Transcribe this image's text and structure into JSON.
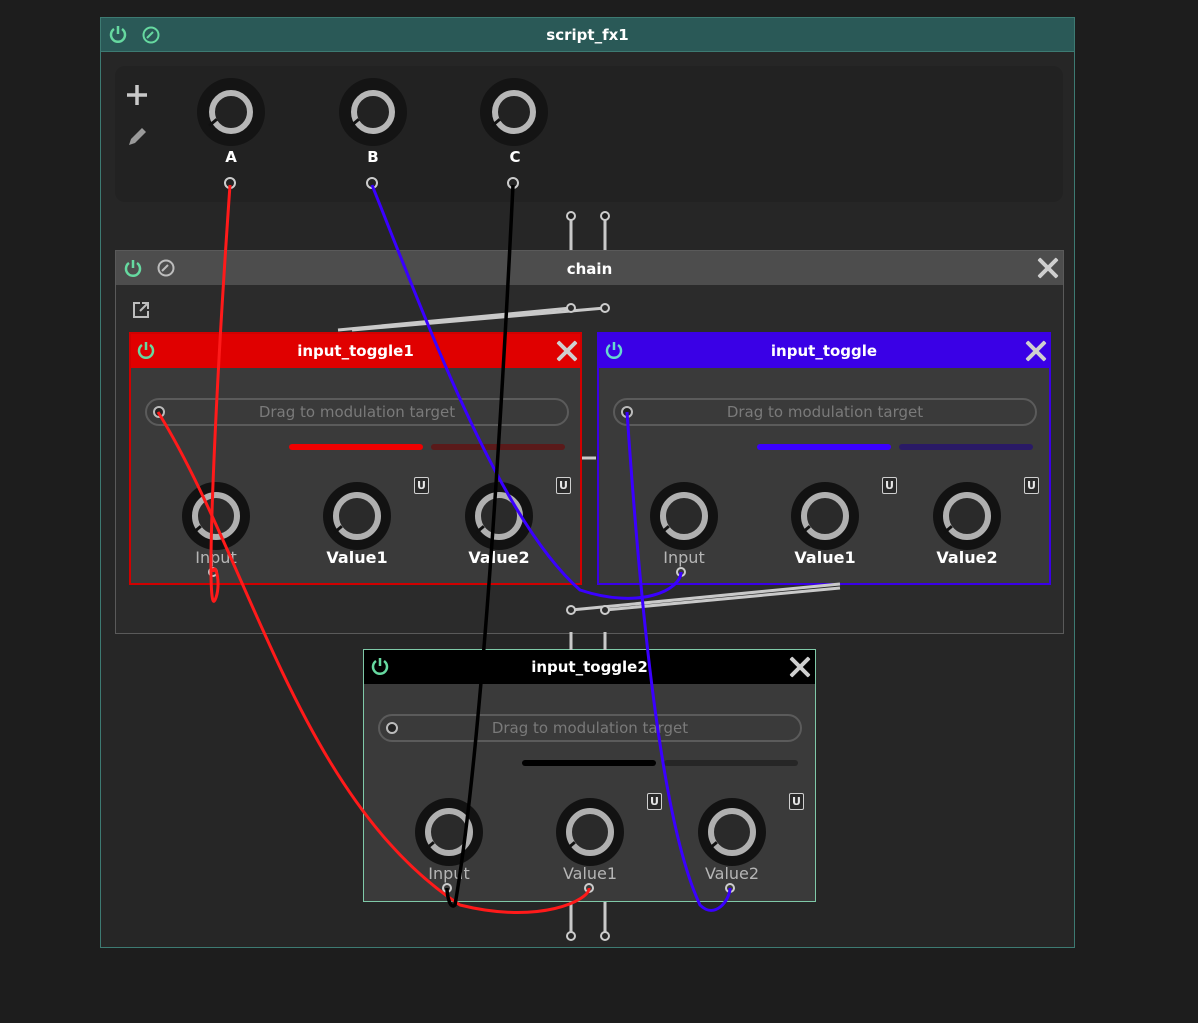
{
  "root": {
    "title": "script_fx1"
  },
  "params": [
    {
      "label": "A"
    },
    {
      "label": "B"
    },
    {
      "label": "C"
    }
  ],
  "chain": {
    "title": "chain"
  },
  "modules": {
    "toggle1": {
      "title": "input_toggle1",
      "color": "#e00000",
      "drag_label": "Drag to modulation target",
      "value_fraction": 0.5,
      "knobs": [
        "Input",
        "Value1",
        "Value2"
      ],
      "unit_badge": "U"
    },
    "toggle": {
      "title": "input_toggle",
      "color": "#3a00e6",
      "drag_label": "Drag to modulation target",
      "value_fraction": 0.5,
      "knobs": [
        "Input",
        "Value1",
        "Value2"
      ],
      "unit_badge": "U"
    },
    "toggle2": {
      "title": "input_toggle2",
      "color": "#000000",
      "drag_label": "Drag to modulation target",
      "value_fraction": 0.5,
      "knobs": [
        "Input",
        "Value1",
        "Value2"
      ],
      "unit_badge": "U"
    }
  },
  "cables": {
    "A": "#ff0000",
    "B": "#3a00e6",
    "C": "#000000"
  }
}
